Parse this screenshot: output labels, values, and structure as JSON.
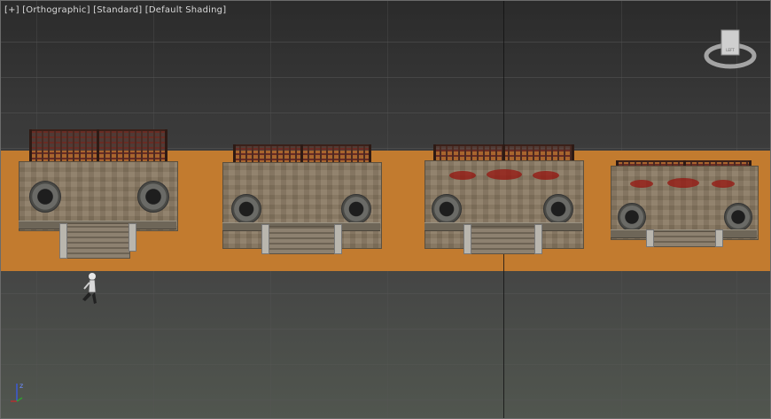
{
  "viewport": {
    "label_parts": [
      "[+]",
      "[Orthographic]",
      "[Standard]",
      "[Default Shading]"
    ],
    "ground_color": "#c27b2f",
    "background_top": "#2b2b2b",
    "background_bottom": "#51564f"
  },
  "viewcube": {
    "face_label": "LEFT"
  },
  "axis": {
    "z_label": "z"
  },
  "icons": [
    "viewcube-icon",
    "axis-tripod-icon",
    "character-figure-icon"
  ]
}
